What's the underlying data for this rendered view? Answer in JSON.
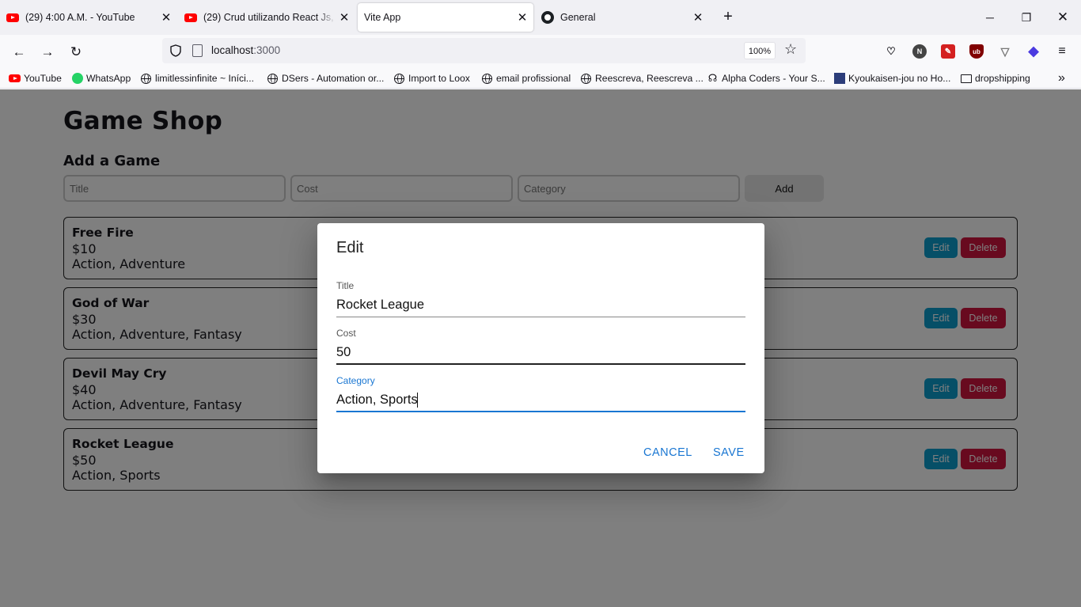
{
  "browser": {
    "tabs": [
      {
        "title": "(29) 4:00 A.M. - YouTube",
        "icon": "youtube-icon"
      },
      {
        "title": "(29) Crud utilizando React Js, Node",
        "icon": "youtube-icon"
      },
      {
        "title": "Vite App",
        "icon": "none",
        "active": true
      },
      {
        "title": "General",
        "icon": "github-icon"
      }
    ],
    "url_host": "localhost",
    "url_port": ":3000",
    "zoom": "100%",
    "bookmarks": [
      {
        "label": "YouTube",
        "icon": "youtube-icon"
      },
      {
        "label": "WhatsApp",
        "icon": "whatsapp-icon"
      },
      {
        "label": "limitlessinfinite ~ Iníci...",
        "icon": "globe-icon"
      },
      {
        "label": "DSers - Automation or...",
        "icon": "globe-icon"
      },
      {
        "label": "Import to Loox",
        "icon": "globe-icon"
      },
      {
        "label": "email profissional",
        "icon": "globe-icon"
      },
      {
        "label": "Reescreva, Reescreva ...",
        "icon": "globe-icon"
      },
      {
        "label": "Alpha Coders - Your S...",
        "icon": "alphacoders-icon"
      },
      {
        "label": "Kyoukaisen-jou no Ho...",
        "icon": "site-icon"
      },
      {
        "label": "dropshipping",
        "icon": "folder-icon"
      }
    ]
  },
  "app": {
    "title": "Game Shop",
    "add_heading": "Add a Game",
    "form": {
      "title_placeholder": "Title",
      "cost_placeholder": "Cost",
      "category_placeholder": "Category",
      "add_label": "Add"
    },
    "games": [
      {
        "title": "Free Fire",
        "cost": "$10",
        "category": "Action, Adventure"
      },
      {
        "title": "God of War",
        "cost": "$30",
        "category": "Action, Adventure, Fantasy"
      },
      {
        "title": "Devil May Cry",
        "cost": "$40",
        "category": "Action, Adventure, Fantasy"
      },
      {
        "title": "Rocket League",
        "cost": "$50",
        "category": "Action, Sports"
      }
    ],
    "edit_label": "Edit",
    "delete_label": "Delete"
  },
  "dialog": {
    "title": "Edit",
    "title_label": "Title",
    "title_value": "Rocket League",
    "cost_label": "Cost",
    "cost_value": "50",
    "category_label": "Category",
    "category_value": "Action, Sports",
    "cancel_label": "CANCEL",
    "save_label": "SAVE"
  },
  "colors": {
    "edit_button": "#0d9ecf",
    "delete_button": "#d0143e",
    "dialog_accent": "#1976d2"
  }
}
